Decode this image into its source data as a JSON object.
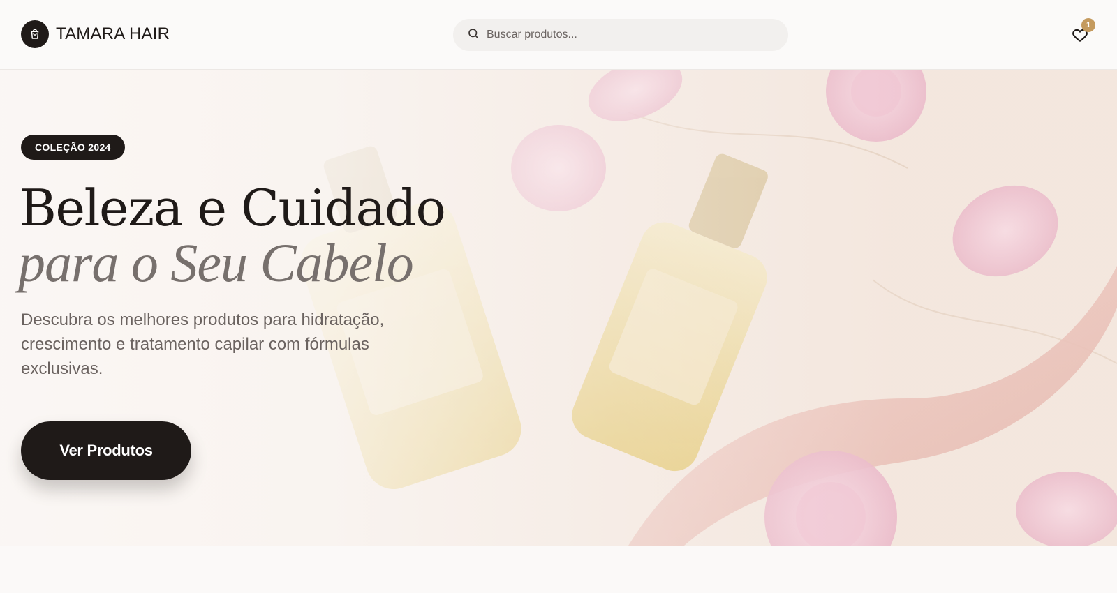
{
  "header": {
    "brand": "TAMARA HAIR",
    "logo_icon": "shopping-bag-icon",
    "search": {
      "placeholder": "Buscar produtos...",
      "icon": "search-icon"
    },
    "favorites": {
      "icon": "heart-icon",
      "count": "1"
    }
  },
  "hero": {
    "badge": "COLEÇÃO 2024",
    "headline_line1": "Beleza e Cuidado",
    "headline_line2": "para o Seu Cabelo",
    "description": "Descubra os melhores produtos para hidratação, crescimento e tratamento capilar com fórmulas exclusivas.",
    "cta_label": "Ver Produtos"
  },
  "colors": {
    "brand_dark": "#1f1a18",
    "accent_gold": "#c49a5e",
    "page_bg": "#fbf9f8"
  }
}
